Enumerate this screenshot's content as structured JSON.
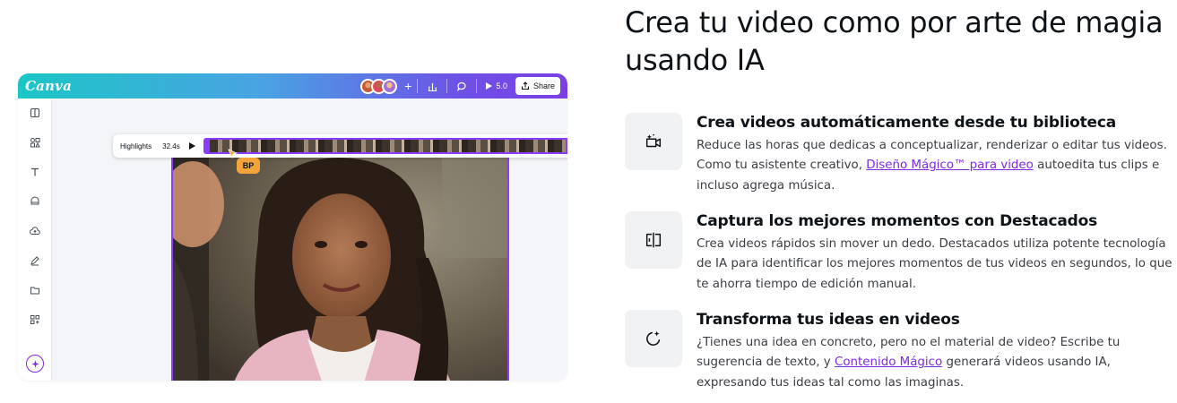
{
  "mockup": {
    "logo": "Canva",
    "toolbar": {
      "add_label": "+",
      "timer_label": "5.0",
      "share_label": "Share"
    },
    "timeline": {
      "label": "Highlights",
      "duration": "32.4s"
    },
    "cursor_badge": "BP",
    "sidebar_icons": [
      "layout-icon",
      "elements-icon",
      "text-icon",
      "brand-icon",
      "uploads-icon",
      "draw-icon",
      "projects-icon",
      "apps-icon",
      "magic-icon"
    ],
    "colors": {
      "accent": "#8b3dff",
      "badge": "#f2a43a"
    }
  },
  "headline": "Crea tu video como por arte de magia usando IA",
  "features": [
    {
      "icon": "video-sparkle-icon",
      "title": "Crea videos automáticamente desde tu biblioteca",
      "desc_before": "Reduce las horas que dedicas a conceptualizar, renderizar o editar tus videos. Como tu asistente creativo, ",
      "link": "Diseño Mágico™ para video",
      "desc_after": " autoedita tus clips e incluso agrega música."
    },
    {
      "icon": "highlights-icon",
      "title": "Captura los mejores momentos con Destacados",
      "desc_before": "Crea videos rápidos sin mover un dedo. Destacados utiliza potente tecnología de IA para identificar los mejores momentos de tus videos en segundos, lo que te ahorra tiempo de edición manual.",
      "link": "",
      "desc_after": ""
    },
    {
      "icon": "magic-moon-icon",
      "title": "Transforma tus ideas en videos",
      "desc_before": "¿Tienes una idea en concreto, pero no el material de video? Escribe tu sugerencia de texto, y ",
      "link": "Contenido Mágico",
      "desc_after": " generará videos usando IA, expresando tus ideas tal como las imaginas."
    }
  ]
}
